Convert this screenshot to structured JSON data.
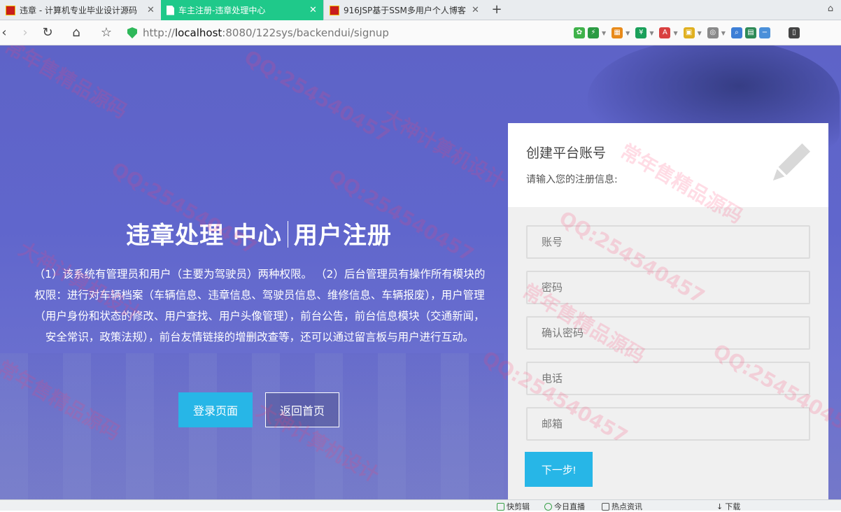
{
  "browser": {
    "tabs": [
      {
        "title": "违章 - 计算机专业毕业设计源码",
        "active": false
      },
      {
        "title": "车主注册-违章处理中心",
        "active": true
      },
      {
        "title": "916JSP基于SSM多用户个人博客",
        "active": false
      }
    ],
    "url": {
      "scheme": "http://",
      "host": "localhost",
      "rest": ":8080/122sys/backendui/signup"
    },
    "new_tab_glyph": "+"
  },
  "hero": {
    "title_left": "违章处理  中心",
    "title_right": "用户注册",
    "description": "（1）该系统有管理员和用户（主要为驾驶员）两种权限。 （2）后台管理员有操作所有模块的权限：进行对车辆档案（车辆信息、违章信息、驾驶员信息、维修信息、车辆报废），用户管理（用户身份和状态的修改、用户查找、用户头像管理），前台公告，前台信息模块（交通新闻，安全常识，政策法规），前台友情链接的增删改查等，还可以通过留言板与用户进行互动。",
    "login_button": "登录页面",
    "home_button": "返回首页"
  },
  "form": {
    "title": "创建平台账号",
    "subtitle": "请输入您的注册信息:",
    "fields": [
      {
        "placeholder": "账号",
        "value": ""
      },
      {
        "placeholder": "密码",
        "value": ""
      },
      {
        "placeholder": "确认密码",
        "value": ""
      },
      {
        "placeholder": "电话",
        "value": ""
      },
      {
        "placeholder": "邮箱",
        "value": ""
      }
    ],
    "next_button": "下一步!"
  },
  "watermarks": [
    "常年售精品源码",
    "QQ:254540457",
    "大神计算机设计"
  ],
  "statusbar": {
    "items": [
      "快剪辑",
      "今日直播",
      "热点资讯",
      "下载"
    ]
  },
  "colors": {
    "active_tab": "#1fc98a",
    "page_background": "#6066cc",
    "accent_button": "#27b6e7",
    "watermark": "#ff3c6e"
  }
}
